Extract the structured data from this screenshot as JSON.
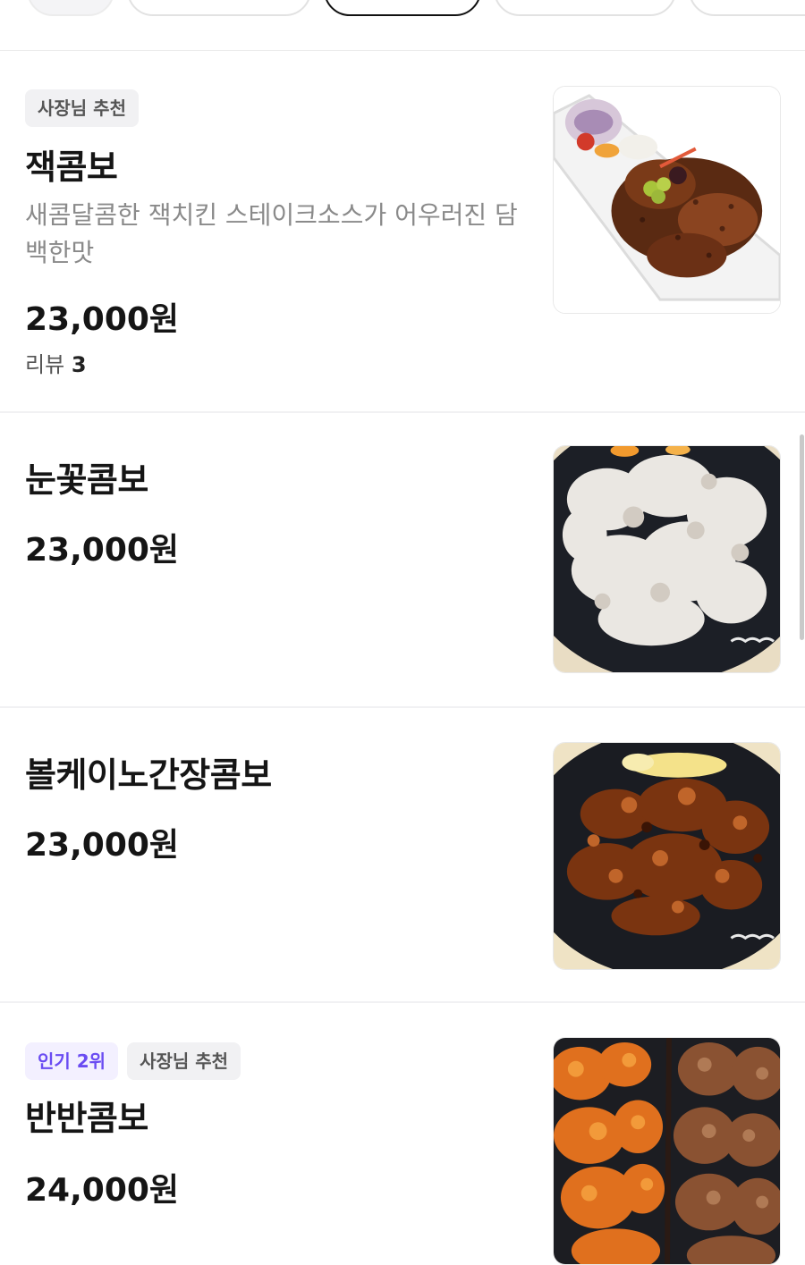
{
  "menu": {
    "items": [
      {
        "badges": [
          "사장님 추천"
        ],
        "name": "잭콤보",
        "description": "새콤달콤한 잭치킨 스테이크소스가 어우러진 담백한맛",
        "price": "23,000원",
        "reviews_label": "리뷰",
        "reviews_count": "3",
        "image": "jack-combo-photo"
      },
      {
        "name": "눈꽃콤보",
        "price": "23,000원",
        "image": "snowflake-combo-photo"
      },
      {
        "name": "볼케이노간장콤보",
        "price": "23,000원",
        "image": "volcano-soy-combo-photo"
      },
      {
        "badges": [
          "인기 2위",
          "사장님 추천"
        ],
        "name": "반반콤보",
        "price": "24,000원",
        "image": "half-half-combo-photo"
      }
    ]
  },
  "colors": {
    "popular_badge_text": "#6a4cf2",
    "popular_badge_bg": "#f3f0ff",
    "owner_badge_bg": "#f1f1f3",
    "description_text": "#8a8a8a"
  }
}
